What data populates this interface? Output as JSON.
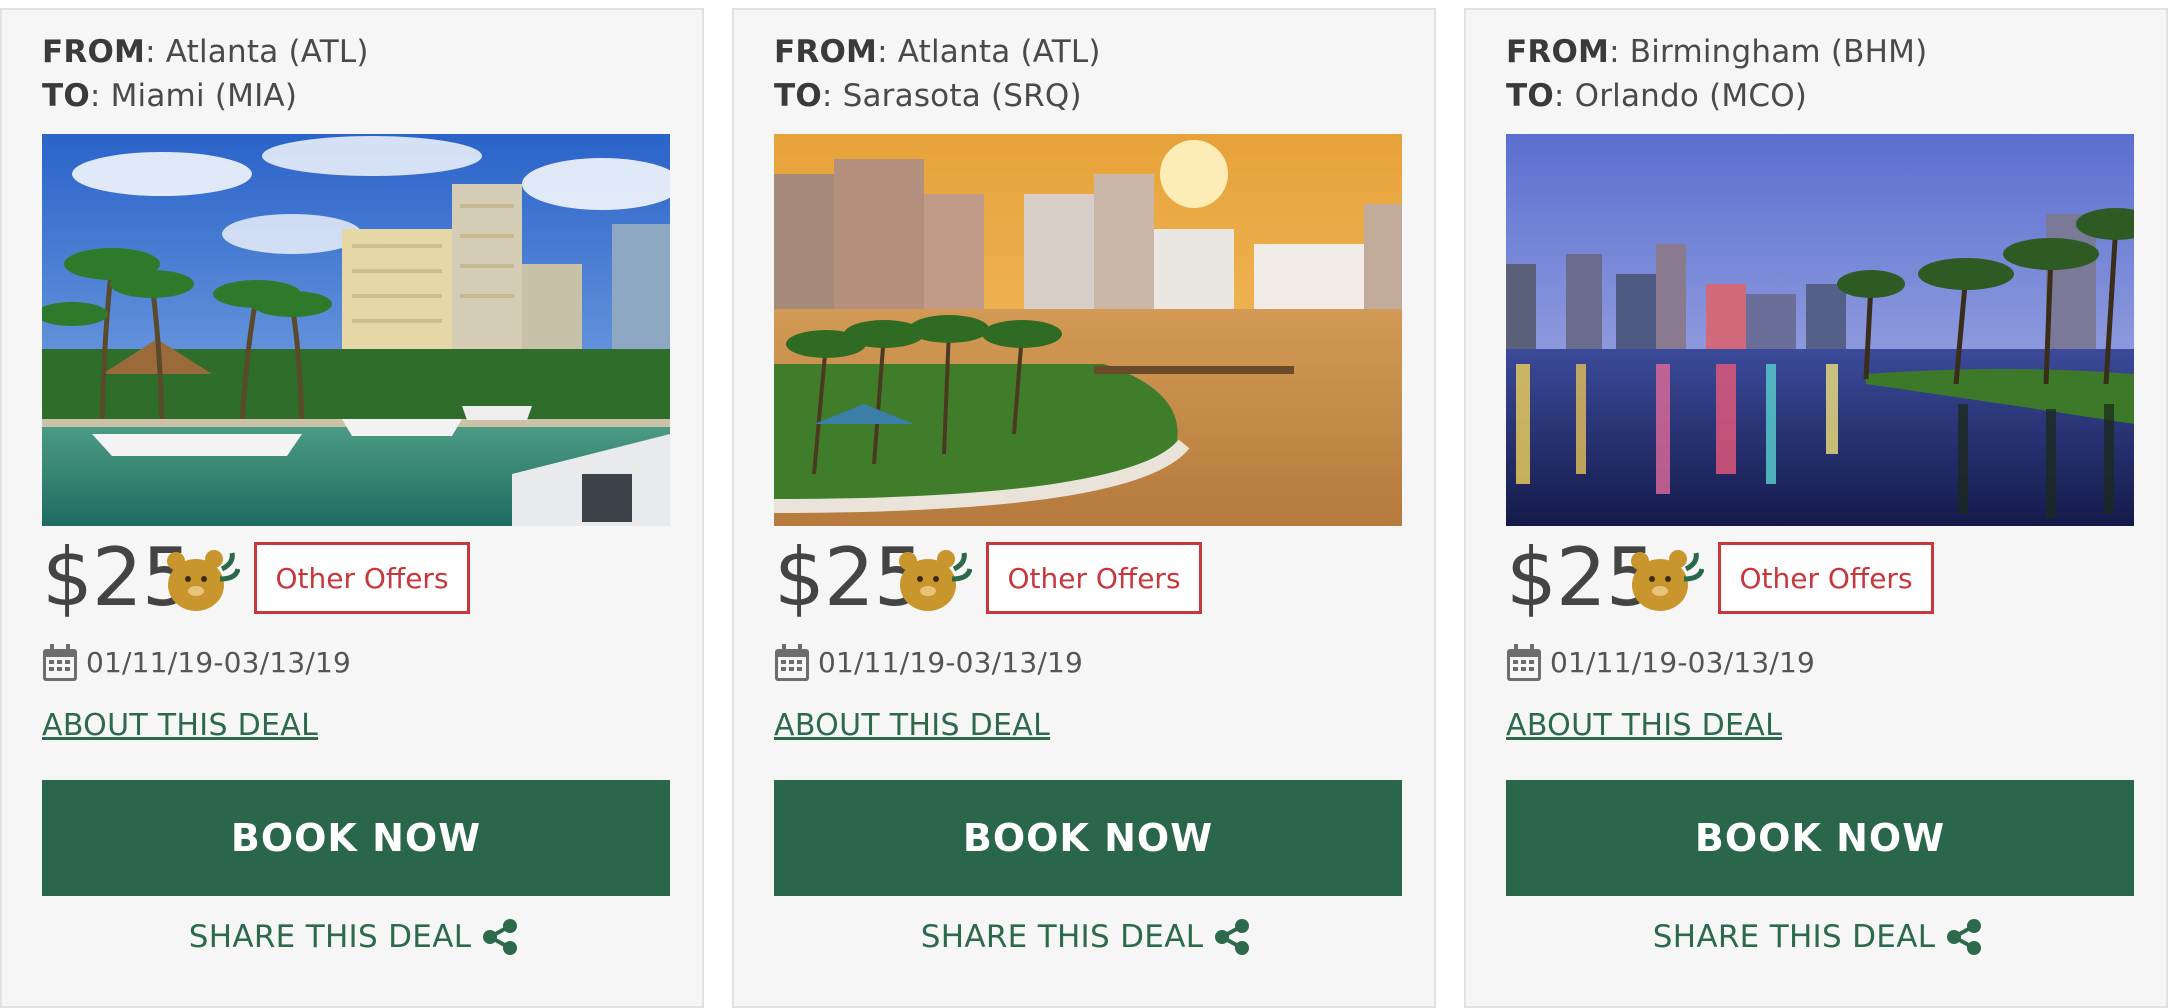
{
  "colors": {
    "brand_green": "#29664a",
    "offers_red": "#c8373c",
    "card_bg": "#f6f6f6"
  },
  "cards": [
    {
      "from_label": "FROM",
      "from_value": ": Atlanta (ATL)",
      "to_label": "TO",
      "to_value": ": Miami (MIA)",
      "photo_icon": "miami-marina-photo",
      "price": "$25",
      "mascot_icon": "bear-mascot-icon",
      "offers_label": "Other Offers",
      "calendar_icon": "calendar-icon",
      "dates": "01/11/19-03/13/19",
      "about_label": "ABOUT THIS DEAL",
      "book_label": "BOOK NOW",
      "share_label": "SHARE THIS DEAL",
      "share_icon": "share-icon"
    },
    {
      "from_label": "FROM",
      "from_value": ": Atlanta (ATL)",
      "to_label": "TO",
      "to_value": ": Sarasota (SRQ)",
      "photo_icon": "sarasota-sunset-photo",
      "price": "$25",
      "mascot_icon": "bear-mascot-icon",
      "offers_label": "Other Offers",
      "calendar_icon": "calendar-icon",
      "dates": "01/11/19-03/13/19",
      "about_label": "ABOUT THIS DEAL",
      "book_label": "BOOK NOW",
      "share_label": "SHARE THIS DEAL",
      "share_icon": "share-icon"
    },
    {
      "from_label": "FROM",
      "from_value": ": Birmingham (BHM)",
      "to_label": "TO",
      "to_value": ": Orlando (MCO)",
      "photo_icon": "orlando-lake-photo",
      "price": "$25",
      "mascot_icon": "bear-mascot-icon",
      "offers_label": "Other Offers",
      "calendar_icon": "calendar-icon",
      "dates": "01/11/19-03/13/19",
      "about_label": "ABOUT THIS DEAL",
      "book_label": "BOOK NOW",
      "share_label": "SHARE THIS DEAL",
      "share_icon": "share-icon"
    }
  ]
}
